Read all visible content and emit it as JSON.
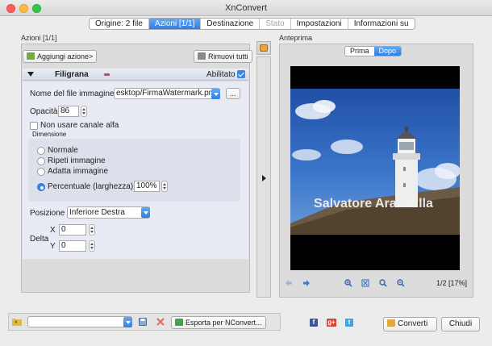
{
  "window": {
    "title": "XnConvert"
  },
  "tabs": [
    {
      "label": "Origine: 2 file",
      "state": "normal"
    },
    {
      "label": "Azioni [1/1]",
      "state": "active"
    },
    {
      "label": "Destinazione",
      "state": "normal"
    },
    {
      "label": "Stato",
      "state": "disabled"
    },
    {
      "label": "Impostazioni",
      "state": "normal"
    },
    {
      "label": "Informazioni su",
      "state": "normal"
    }
  ],
  "actions": {
    "section_label": "Azioni [1/1]",
    "add_button": "Aggiungi azione>",
    "remove_all_button": "Rimuovi tutti",
    "filter_title": "Filigrana",
    "enabled_label": "Abilitato",
    "enabled": true,
    "file_label": "Nome del file immagine",
    "file_value": "esktop/FirmaWatermark.png",
    "browse_label": "...",
    "opacity_label": "Opacità",
    "opacity_value": "86",
    "alpha_label": "Non usare canale alfa",
    "alpha_checked": false,
    "dimension_label": "Dimensione",
    "size_options": [
      {
        "label": "Normale",
        "selected": false
      },
      {
        "label": "Ripeti immagine",
        "selected": false
      },
      {
        "label": "Adatta immagine",
        "selected": false
      },
      {
        "label": "Percentuale (larghezza)",
        "selected": true
      }
    ],
    "percent_value": "100%",
    "position_label": "Posizione",
    "position_value": "Inferiore Destra",
    "delta_label": "Delta",
    "x_label": "X",
    "x_value": "0",
    "y_label": "Y",
    "y_value": "0"
  },
  "preview": {
    "section_label": "Anteprima",
    "before_label": "Prima",
    "after_label": "Dopo",
    "active": "Dopo",
    "watermark_text": "Salvatore Aranzulla",
    "page_info": "1/2 [17%]"
  },
  "bottom": {
    "export_button": "Esporta per NConvert...",
    "convert_button": "Converti",
    "close_button": "Chiudi"
  },
  "colors": {
    "accent": "#2f7fe6",
    "sky": "#3d73c8",
    "lighthouse": "#eeeeee"
  }
}
